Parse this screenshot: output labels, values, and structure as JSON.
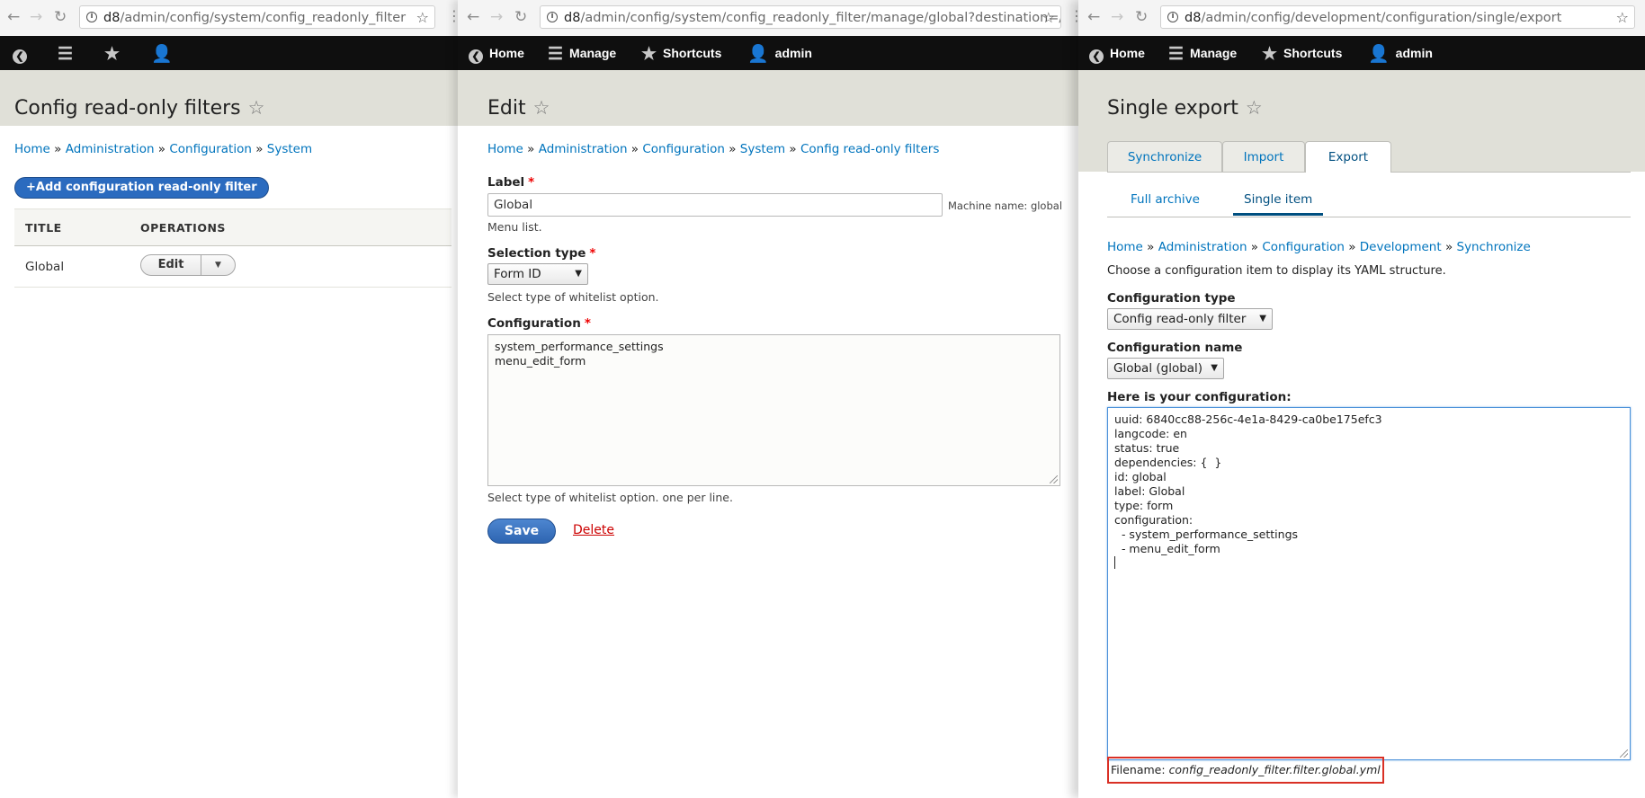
{
  "pane1": {
    "url_host": "d8",
    "url_path": "/admin/config/system/config_readonly_filter",
    "title": "Config read-only filters",
    "breadcrumb": [
      "Home",
      "Administration",
      "Configuration",
      "System"
    ],
    "add_button": "Add configuration read-only filter",
    "table": {
      "headers": [
        "TITLE",
        "OPERATIONS"
      ],
      "rows": [
        {
          "title": "Global",
          "operation": "Edit"
        }
      ]
    }
  },
  "pane2": {
    "url_host": "d8",
    "url_path": "/admin/config/system/config_readonly_filter/manage/global?destination=/a...",
    "toolbar": {
      "home": "Home",
      "manage": "Manage",
      "shortcuts": "Shortcuts",
      "user": "admin"
    },
    "title": "Edit",
    "breadcrumb": [
      "Home",
      "Administration",
      "Configuration",
      "System",
      "Config read-only filters"
    ],
    "label_field": {
      "label": "Label",
      "value": "Global",
      "machine_name": "Machine name: global",
      "description": "Menu list."
    },
    "selection_type": {
      "label": "Selection type",
      "value": "Form ID",
      "description": "Select type of whitelist option."
    },
    "configuration": {
      "label": "Configuration",
      "value": "system_performance_settings\nmenu_edit_form",
      "description": "Select type of whitelist option. one per line."
    },
    "save_button": "Save",
    "delete_link": "Delete"
  },
  "pane3": {
    "url_host": "d8",
    "url_path": "/admin/config/development/configuration/single/export",
    "toolbar": {
      "home": "Home",
      "manage": "Manage",
      "shortcuts": "Shortcuts",
      "user": "admin"
    },
    "title": "Single export",
    "tabs": [
      "Synchronize",
      "Import",
      "Export"
    ],
    "subtabs": [
      "Full archive",
      "Single item"
    ],
    "breadcrumb": [
      "Home",
      "Administration",
      "Configuration",
      "Development",
      "Synchronize"
    ],
    "intro": "Choose a configuration item to display its YAML structure.",
    "config_type": {
      "label": "Configuration type",
      "value": "Config read-only filter"
    },
    "config_name": {
      "label": "Configuration name",
      "value": "Global (global)"
    },
    "output_label": "Here is your configuration:",
    "yaml": "uuid: 6840cc88-256c-4e1a-8429-ca0be175efc3\nlangcode: en\nstatus: true\ndependencies: {  }\nid: global\nlabel: Global\ntype: form\nconfiguration:\n  - system_performance_settings\n  - menu_edit_form\n",
    "filename_label": "Filename:",
    "filename_value": "config_readonly_filter.filter.global.yml"
  },
  "icons": {
    "back": "chevron-left-circle-icon",
    "forward": "chevron-right-icon",
    "reload": "reload-icon",
    "info": "info-icon",
    "bookmark": "star-outline-icon",
    "manage": "hamburger-icon",
    "shortcuts": "star-icon",
    "user": "user-icon"
  },
  "colors": {
    "link": "#0074bd",
    "toolbar": "#0f0f0f",
    "band": "#e0e0d8",
    "primary": "#2e65b1",
    "highlight": "#d93025"
  }
}
